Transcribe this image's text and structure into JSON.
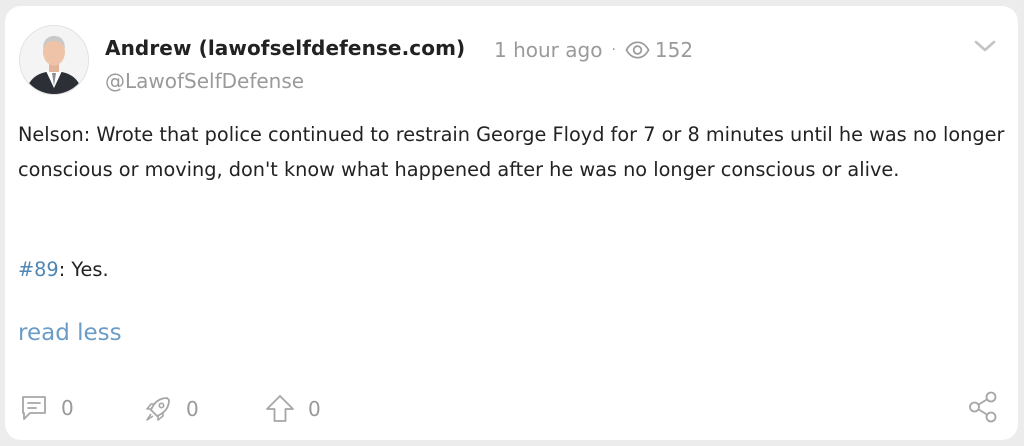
{
  "post": {
    "author_name": "Andrew (lawofselfdefense.com)",
    "time_ago": "1 hour ago",
    "separator": "·",
    "views": "152",
    "handle": "@LawofSelfDefense",
    "body": "Nelson: Wrote that police continued to restrain George Floyd for 7 or 8 minutes until he was no longer conscious or moving, don't know what happened after he was no longer conscious or alive.",
    "hashtag": "#89",
    "hashtag_suffix": ": Yes.",
    "read_less": "read less"
  },
  "actions": {
    "comments_count": "0",
    "boosts_count": "0",
    "upvotes_count": "0"
  },
  "icons": {
    "avatar": "author-photo",
    "views": "eye-icon",
    "menu": "chevron-down-icon",
    "comment": "comment-icon",
    "boost": "rocket-icon",
    "upvote": "arrow-up-icon",
    "share": "share-icon"
  },
  "colors": {
    "background": "#ececec",
    "card": "#ffffff",
    "text": "#222222",
    "muted": "#9a9a9a",
    "link": "#4f86b4",
    "read_less": "#6a9cc6"
  }
}
